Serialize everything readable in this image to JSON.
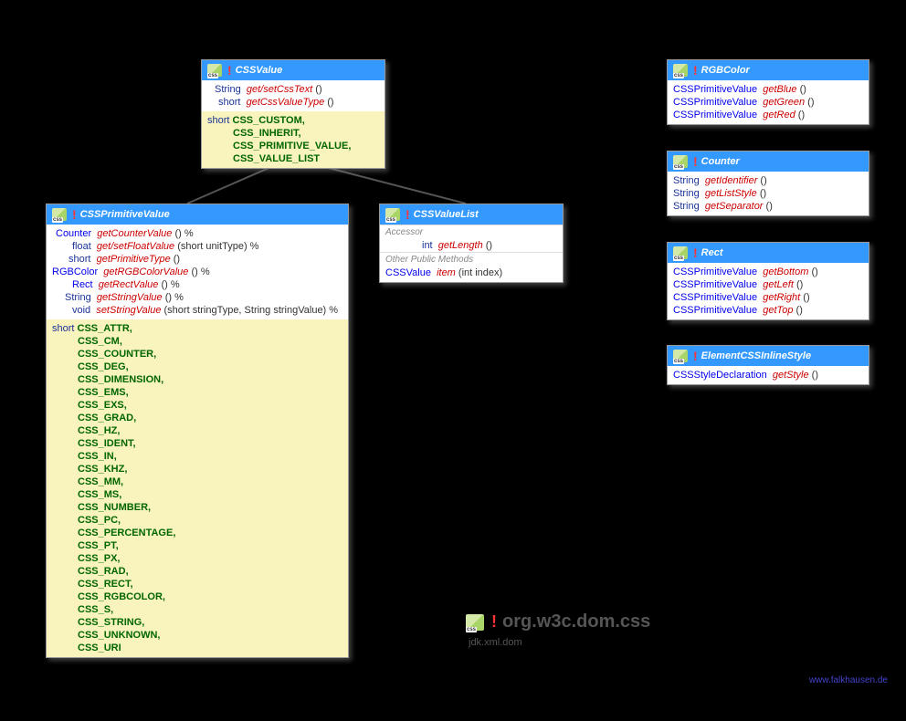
{
  "cssValue": {
    "title": "CSSValue",
    "methods": [
      {
        "ret": "String",
        "name": "get/setCssText",
        "params": "()"
      },
      {
        "ret": "short",
        "name": "getCssValueType",
        "params": "()"
      }
    ],
    "const_prefix": "short",
    "constants": [
      "CSS_CUSTOM,",
      "CSS_INHERIT,",
      "CSS_PRIMITIVE_VALUE,",
      "CSS_VALUE_LIST"
    ]
  },
  "cssPrimitive": {
    "title": "CSSPrimitiveValue",
    "methods": [
      {
        "ret": "Counter",
        "name": "getCounterValue",
        "params": "() %",
        "link": true
      },
      {
        "ret": "float",
        "name": "get/setFloatValue",
        "params": "(short unitType) %"
      },
      {
        "ret": "short",
        "name": "getPrimitiveType",
        "params": "()"
      },
      {
        "ret": "RGBColor",
        "name": "getRGBColorValue",
        "params": "() %",
        "link": true
      },
      {
        "ret": "Rect",
        "name": "getRectValue",
        "params": "() %",
        "link": true
      },
      {
        "ret": "String",
        "name": "getStringValue",
        "params": "() %"
      },
      {
        "ret": "void",
        "name": "setStringValue",
        "params": "(short stringType, String stringValue) %"
      }
    ],
    "const_prefix": "short",
    "constants": [
      "CSS_ATTR,",
      "CSS_CM,",
      "CSS_COUNTER,",
      "CSS_DEG,",
      "CSS_DIMENSION,",
      "CSS_EMS,",
      "CSS_EXS,",
      "CSS_GRAD,",
      "CSS_HZ,",
      "CSS_IDENT,",
      "CSS_IN,",
      "CSS_KHZ,",
      "CSS_MM,",
      "CSS_MS,",
      "CSS_NUMBER,",
      "CSS_PC,",
      "CSS_PERCENTAGE,",
      "CSS_PT,",
      "CSS_PX,",
      "CSS_RAD,",
      "CSS_RECT,",
      "CSS_RGBCOLOR,",
      "CSS_S,",
      "CSS_STRING,",
      "CSS_UNKNOWN,",
      "CSS_URI"
    ]
  },
  "cssValueList": {
    "title": "CSSValueList",
    "section1": "Accessor",
    "methods1": [
      {
        "ret": "int",
        "name": "getLength",
        "params": "()"
      }
    ],
    "section2": "Other Public Methods",
    "methods2": [
      {
        "ret": "CSSValue",
        "name": "item",
        "params": "(int index)",
        "link": true
      }
    ]
  },
  "rgbColor": {
    "title": "RGBColor",
    "methods": [
      {
        "ret": "CSSPrimitiveValue",
        "name": "getBlue",
        "params": "()",
        "link": true
      },
      {
        "ret": "CSSPrimitiveValue",
        "name": "getGreen",
        "params": "()",
        "link": true
      },
      {
        "ret": "CSSPrimitiveValue",
        "name": "getRed",
        "params": "()",
        "link": true
      }
    ]
  },
  "counter": {
    "title": "Counter",
    "methods": [
      {
        "ret": "String",
        "name": "getIdentifier",
        "params": "()"
      },
      {
        "ret": "String",
        "name": "getListStyle",
        "params": "()"
      },
      {
        "ret": "String",
        "name": "getSeparator",
        "params": "()"
      }
    ]
  },
  "rect": {
    "title": "Rect",
    "methods": [
      {
        "ret": "CSSPrimitiveValue",
        "name": "getBottom",
        "params": "()",
        "link": true
      },
      {
        "ret": "CSSPrimitiveValue",
        "name": "getLeft",
        "params": "()",
        "link": true
      },
      {
        "ret": "CSSPrimitiveValue",
        "name": "getRight",
        "params": "()",
        "link": true
      },
      {
        "ret": "CSSPrimitiveValue",
        "name": "getTop",
        "params": "()",
        "link": true
      }
    ]
  },
  "elementInline": {
    "title": "ElementCSSInlineStyle",
    "methods": [
      {
        "ret": "CSSStyleDeclaration",
        "name": "getStyle",
        "params": "()",
        "link": true
      }
    ]
  },
  "package": {
    "name": "org.w3c.dom.css",
    "module": "jdk.xml.dom"
  },
  "footer": "www.falkhausen.de"
}
